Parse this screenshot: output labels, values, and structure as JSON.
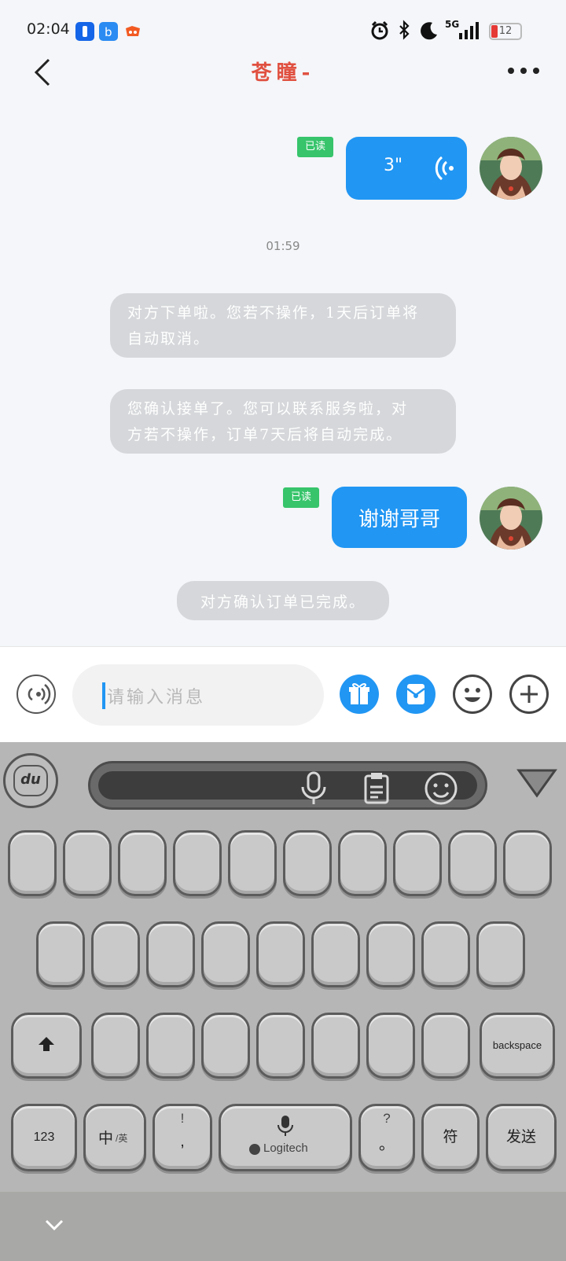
{
  "status": {
    "time": "02:04",
    "network": "5G",
    "battery": "12"
  },
  "header": {
    "title": "苍瞳-"
  },
  "chat": {
    "voice": {
      "read": "已读",
      "duration": "3\""
    },
    "timestamp": "01:59",
    "sys1": [
      "对方下单啦。您若不操作，1天后订单将",
      "自动取消。"
    ],
    "sys2": [
      "您确认接单了。您可以联系服务啦，对",
      "方若不操作，订单7天后将自动完成。"
    ],
    "text_msg": {
      "read": "已读",
      "text": "谢谢哥哥"
    },
    "sys3": "对方确认订单已完成。"
  },
  "input": {
    "placeholder": "请输入消息"
  },
  "keyboard": {
    "logo": "du",
    "backspace": "backspace",
    "k123": "123",
    "zh": "中",
    "zh_sub": "/英",
    "punct_top": "!",
    "punct_bot": ",",
    "space_brand": "Logitech",
    "q_top": "?",
    "q_bot": "。",
    "symbol": "符",
    "send": "发送"
  },
  "colors": {
    "accent": "#2196f3",
    "title": "#e05040",
    "read_badge": "#37c46b"
  }
}
